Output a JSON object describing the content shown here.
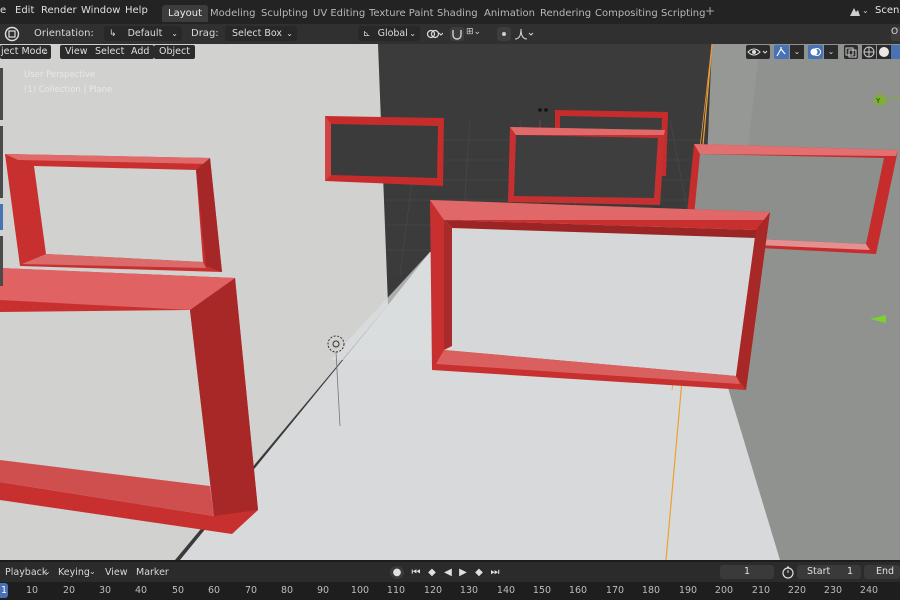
{
  "menu": [
    {
      "id": "blender",
      "label": "e"
    },
    {
      "id": "edit",
      "label": "Edit"
    },
    {
      "id": "render",
      "label": "Render"
    },
    {
      "id": "window",
      "label": "Window"
    },
    {
      "id": "help",
      "label": "Help"
    }
  ],
  "workspaces": [
    "Layout",
    "Modeling",
    "Sculpting",
    "UV Editing",
    "Texture Paint",
    "Shading",
    "Animation",
    "Rendering",
    "Compositing",
    "Scripting"
  ],
  "active_workspace": "Layout",
  "scene_label": "Scene",
  "tool_header": {
    "orientation_label": "Orientation:",
    "orientation_value": "Default",
    "drag_label": "Drag:",
    "drag_value": "Select Box",
    "transform_orientation": "Global"
  },
  "viewport_header": {
    "mode": "ject Mode",
    "view": "View",
    "select": "Select",
    "add": "Add",
    "object": "Object"
  },
  "viewport_overlay": {
    "perspective": "User Perspective",
    "collection": "(1) Collection | Plane"
  },
  "gizmo": {
    "y_axis": "Y"
  },
  "timeline": {
    "playback": "Playback",
    "keying": "Keying",
    "view": "View",
    "marker": "Marker",
    "current_frame": "1",
    "start_label": "Start",
    "start_value": "1",
    "end_label": "End"
  },
  "ruler_ticks": [
    "1",
    "10",
    "20",
    "30",
    "40",
    "50",
    "60",
    "70",
    "80",
    "90",
    "100",
    "110",
    "120",
    "130",
    "140",
    "150",
    "160",
    "170",
    "180",
    "190",
    "200",
    "210",
    "220",
    "230",
    "240"
  ],
  "colors": {
    "accent": "#4772b3",
    "frame_red": "#c8302f",
    "floor": "#d4d6d8",
    "wall_left": "#cfcfcd",
    "wall_right": "#8e918d"
  }
}
